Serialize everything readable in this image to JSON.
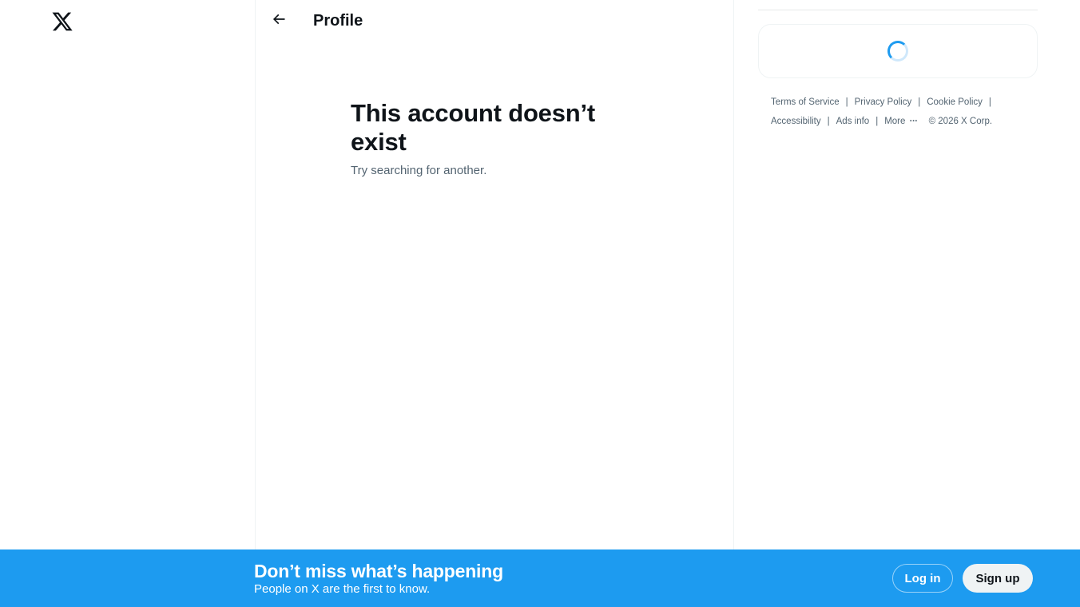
{
  "brand": {
    "logo_icon": "x-logo-icon"
  },
  "header": {
    "back_icon": "arrow-left-icon",
    "title": "Profile"
  },
  "empty_state": {
    "title": "This account doesn’t exist",
    "subtitle": "Try searching for another."
  },
  "sidebar_right": {
    "loading_icon": "spinner-icon",
    "footer": {
      "links_row1": [
        "Terms of Service",
        "Privacy Policy",
        "Cookie Policy"
      ],
      "links_row2": [
        "Accessibility",
        "Ads info",
        "More"
      ],
      "more_icon": "ellipsis-icon",
      "separator": "|",
      "copyright": "© 2026 X Corp."
    }
  },
  "bottom_bar": {
    "title": "Don’t miss what’s happening",
    "subtitle": "People on X are the first to know.",
    "login_label": "Log in",
    "signup_label": "Sign up"
  },
  "colors": {
    "accent": "#1d9bf0",
    "text_primary": "#0f1419",
    "text_secondary": "#536471",
    "border": "#eff3f4"
  }
}
